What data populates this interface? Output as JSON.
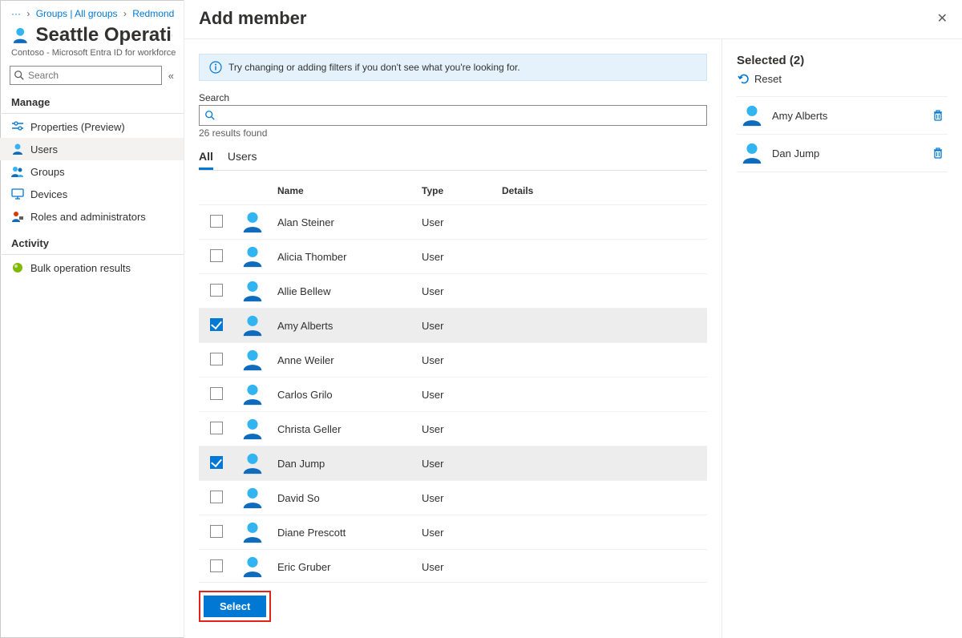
{
  "breadcrumb": {
    "ellipsis": "···",
    "groups": "Groups | All groups",
    "path2": "Redmond"
  },
  "page": {
    "title": "Seattle Operations",
    "subtitle": "Contoso - Microsoft Entra ID for workforce"
  },
  "sidebar": {
    "search_placeholder": "Search",
    "sections": {
      "manage_label": "Manage",
      "activity_label": "Activity"
    },
    "items": {
      "properties": "Properties (Preview)",
      "users": "Users",
      "groups": "Groups",
      "devices": "Devices",
      "roles": "Roles and administrators",
      "bulk": "Bulk operation results"
    }
  },
  "blade": {
    "title": "Add member",
    "info": "Try changing or adding filters if you don't see what you're looking for.",
    "search_label": "Search",
    "result_count": "26 results found",
    "tabs": {
      "all": "All",
      "users": "Users"
    },
    "columns": {
      "name": "Name",
      "type": "Type",
      "details": "Details"
    },
    "rows": [
      {
        "name": "Alan Steiner",
        "type": "User",
        "checked": false
      },
      {
        "name": "Alicia Thomber",
        "type": "User",
        "checked": false
      },
      {
        "name": "Allie Bellew",
        "type": "User",
        "checked": false
      },
      {
        "name": "Amy Alberts",
        "type": "User",
        "checked": true
      },
      {
        "name": "Anne Weiler",
        "type": "User",
        "checked": false
      },
      {
        "name": "Carlos Grilo",
        "type": "User",
        "checked": false
      },
      {
        "name": "Christa Geller",
        "type": "User",
        "checked": false
      },
      {
        "name": "Dan Jump",
        "type": "User",
        "checked": true
      },
      {
        "name": "David So",
        "type": "User",
        "checked": false
      },
      {
        "name": "Diane Prescott",
        "type": "User",
        "checked": false
      },
      {
        "name": "Eric Gruber",
        "type": "User",
        "checked": false
      }
    ],
    "selected_heading": "Selected (2)",
    "reset_label": "Reset",
    "selected": [
      {
        "name": "Amy Alberts"
      },
      {
        "name": "Dan Jump"
      }
    ],
    "select_button": "Select"
  }
}
